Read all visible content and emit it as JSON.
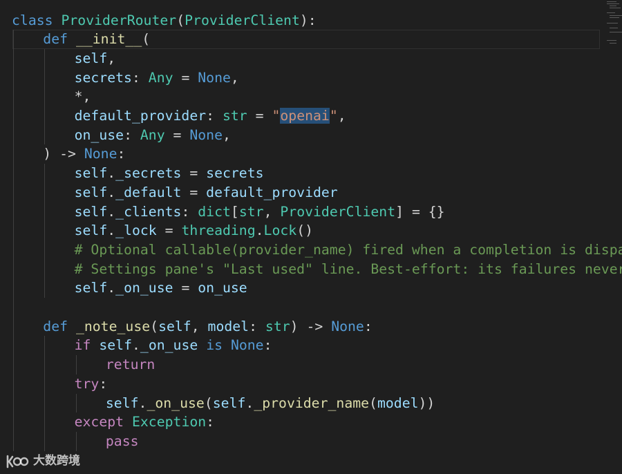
{
  "colors": {
    "background": "#1f1f1f",
    "keyword": "#569cd6",
    "control": "#c586c0",
    "class_type": "#4ec9b0",
    "function": "#dcdcaa",
    "variable": "#9cdcfe",
    "string": "#ce9178",
    "comment": "#6a9955",
    "default": "#d4d4d4",
    "selection": "#264f78"
  },
  "code": {
    "lines": [
      {
        "indent": 0,
        "tokens": [
          {
            "t": "class",
            "c": "kw"
          },
          {
            "t": " ",
            "c": "def"
          },
          {
            "t": "ProviderRouter",
            "c": "cls"
          },
          {
            "t": "(",
            "c": "def"
          },
          {
            "t": "ProviderClient",
            "c": "cls"
          },
          {
            "t": "):",
            "c": "def"
          }
        ]
      },
      {
        "indent": 1,
        "tokens": [
          {
            "t": "def",
            "c": "kw"
          },
          {
            "t": " ",
            "c": "def"
          },
          {
            "t": "__init__",
            "c": "fn"
          },
          {
            "t": "(",
            "c": "def"
          }
        ]
      },
      {
        "indent": 2,
        "tokens": [
          {
            "t": "self",
            "c": "var"
          },
          {
            "t": ",",
            "c": "def"
          }
        ]
      },
      {
        "indent": 2,
        "tokens": [
          {
            "t": "secrets",
            "c": "var"
          },
          {
            "t": ": ",
            "c": "def"
          },
          {
            "t": "Any",
            "c": "cls"
          },
          {
            "t": " = ",
            "c": "def"
          },
          {
            "t": "None",
            "c": "kw"
          },
          {
            "t": ",",
            "c": "def"
          }
        ]
      },
      {
        "indent": 2,
        "tokens": [
          {
            "t": "*,",
            "c": "def"
          }
        ]
      },
      {
        "indent": 2,
        "tokens": [
          {
            "t": "default_provider",
            "c": "var"
          },
          {
            "t": ": ",
            "c": "def"
          },
          {
            "t": "str",
            "c": "cls"
          },
          {
            "t": " = ",
            "c": "def"
          },
          {
            "t": "\"",
            "c": "str"
          },
          {
            "t": "openai",
            "c": "str",
            "sel": true
          },
          {
            "t": "\"",
            "c": "str"
          },
          {
            "t": ",",
            "c": "def"
          }
        ]
      },
      {
        "indent": 2,
        "tokens": [
          {
            "t": "on_use",
            "c": "var"
          },
          {
            "t": ": ",
            "c": "def"
          },
          {
            "t": "Any",
            "c": "cls"
          },
          {
            "t": " = ",
            "c": "def"
          },
          {
            "t": "None",
            "c": "kw"
          },
          {
            "t": ",",
            "c": "def"
          }
        ]
      },
      {
        "indent": 1,
        "tokens": [
          {
            "t": ")",
            "c": "def"
          },
          {
            "t": " -> ",
            "c": "def"
          },
          {
            "t": "None",
            "c": "kw"
          },
          {
            "t": ":",
            "c": "def"
          }
        ]
      },
      {
        "indent": 2,
        "tokens": [
          {
            "t": "self",
            "c": "var"
          },
          {
            "t": ".",
            "c": "def"
          },
          {
            "t": "_secrets",
            "c": "var"
          },
          {
            "t": " = ",
            "c": "def"
          },
          {
            "t": "secrets",
            "c": "var"
          }
        ]
      },
      {
        "indent": 2,
        "tokens": [
          {
            "t": "self",
            "c": "var"
          },
          {
            "t": ".",
            "c": "def"
          },
          {
            "t": "_default",
            "c": "var"
          },
          {
            "t": " = ",
            "c": "def"
          },
          {
            "t": "default_provider",
            "c": "var"
          }
        ]
      },
      {
        "indent": 2,
        "tokens": [
          {
            "t": "self",
            "c": "var"
          },
          {
            "t": ".",
            "c": "def"
          },
          {
            "t": "_clients",
            "c": "var"
          },
          {
            "t": ": ",
            "c": "def"
          },
          {
            "t": "dict",
            "c": "cls"
          },
          {
            "t": "[",
            "c": "def"
          },
          {
            "t": "str",
            "c": "cls"
          },
          {
            "t": ", ",
            "c": "def"
          },
          {
            "t": "ProviderClient",
            "c": "cls"
          },
          {
            "t": "] = {}",
            "c": "def"
          }
        ]
      },
      {
        "indent": 2,
        "tokens": [
          {
            "t": "self",
            "c": "var"
          },
          {
            "t": ".",
            "c": "def"
          },
          {
            "t": "_lock",
            "c": "var"
          },
          {
            "t": " = ",
            "c": "def"
          },
          {
            "t": "threading",
            "c": "cls"
          },
          {
            "t": ".",
            "c": "def"
          },
          {
            "t": "Lock",
            "c": "cls"
          },
          {
            "t": "()",
            "c": "def"
          }
        ]
      },
      {
        "indent": 2,
        "tokens": [
          {
            "t": "# Optional callable(provider_name) fired when a completion is dispatched",
            "c": "cmt"
          }
        ]
      },
      {
        "indent": 2,
        "tokens": [
          {
            "t": "# Settings pane's \"Last used\" line. Best-effort: its failures never break",
            "c": "cmt"
          }
        ]
      },
      {
        "indent": 2,
        "tokens": [
          {
            "t": "self",
            "c": "var"
          },
          {
            "t": ".",
            "c": "def"
          },
          {
            "t": "_on_use",
            "c": "var"
          },
          {
            "t": " = ",
            "c": "def"
          },
          {
            "t": "on_use",
            "c": "var"
          }
        ]
      },
      {
        "indent": 0,
        "tokens": []
      },
      {
        "indent": 1,
        "tokens": [
          {
            "t": "def",
            "c": "kw"
          },
          {
            "t": " ",
            "c": "def"
          },
          {
            "t": "_note_use",
            "c": "fn"
          },
          {
            "t": "(",
            "c": "def"
          },
          {
            "t": "self",
            "c": "var"
          },
          {
            "t": ", ",
            "c": "def"
          },
          {
            "t": "model",
            "c": "var"
          },
          {
            "t": ": ",
            "c": "def"
          },
          {
            "t": "str",
            "c": "cls"
          },
          {
            "t": ") -> ",
            "c": "def"
          },
          {
            "t": "None",
            "c": "kw"
          },
          {
            "t": ":",
            "c": "def"
          }
        ]
      },
      {
        "indent": 2,
        "tokens": [
          {
            "t": "if",
            "c": "ctl"
          },
          {
            "t": " ",
            "c": "def"
          },
          {
            "t": "self",
            "c": "var"
          },
          {
            "t": ".",
            "c": "def"
          },
          {
            "t": "_on_use",
            "c": "var"
          },
          {
            "t": " ",
            "c": "def"
          },
          {
            "t": "is",
            "c": "kw"
          },
          {
            "t": " ",
            "c": "def"
          },
          {
            "t": "None",
            "c": "kw"
          },
          {
            "t": ":",
            "c": "def"
          }
        ]
      },
      {
        "indent": 3,
        "tokens": [
          {
            "t": "return",
            "c": "ctl"
          }
        ]
      },
      {
        "indent": 2,
        "tokens": [
          {
            "t": "try",
            "c": "ctl"
          },
          {
            "t": ":",
            "c": "def"
          }
        ]
      },
      {
        "indent": 3,
        "tokens": [
          {
            "t": "self",
            "c": "var"
          },
          {
            "t": ".",
            "c": "def"
          },
          {
            "t": "_on_use",
            "c": "fn"
          },
          {
            "t": "(",
            "c": "def"
          },
          {
            "t": "self",
            "c": "var"
          },
          {
            "t": ".",
            "c": "def"
          },
          {
            "t": "_provider_name",
            "c": "fn"
          },
          {
            "t": "(",
            "c": "def"
          },
          {
            "t": "model",
            "c": "var"
          },
          {
            "t": "))",
            "c": "def"
          }
        ]
      },
      {
        "indent": 2,
        "tokens": [
          {
            "t": "except",
            "c": "ctl"
          },
          {
            "t": " ",
            "c": "def"
          },
          {
            "t": "Exception",
            "c": "cls"
          },
          {
            "t": ":",
            "c": "def"
          }
        ]
      },
      {
        "indent": 3,
        "tokens": [
          {
            "t": "pass",
            "c": "ctl"
          }
        ]
      }
    ]
  },
  "watermark": {
    "text": "大数跨境",
    "logo_icon": "kico-logo-icon"
  }
}
